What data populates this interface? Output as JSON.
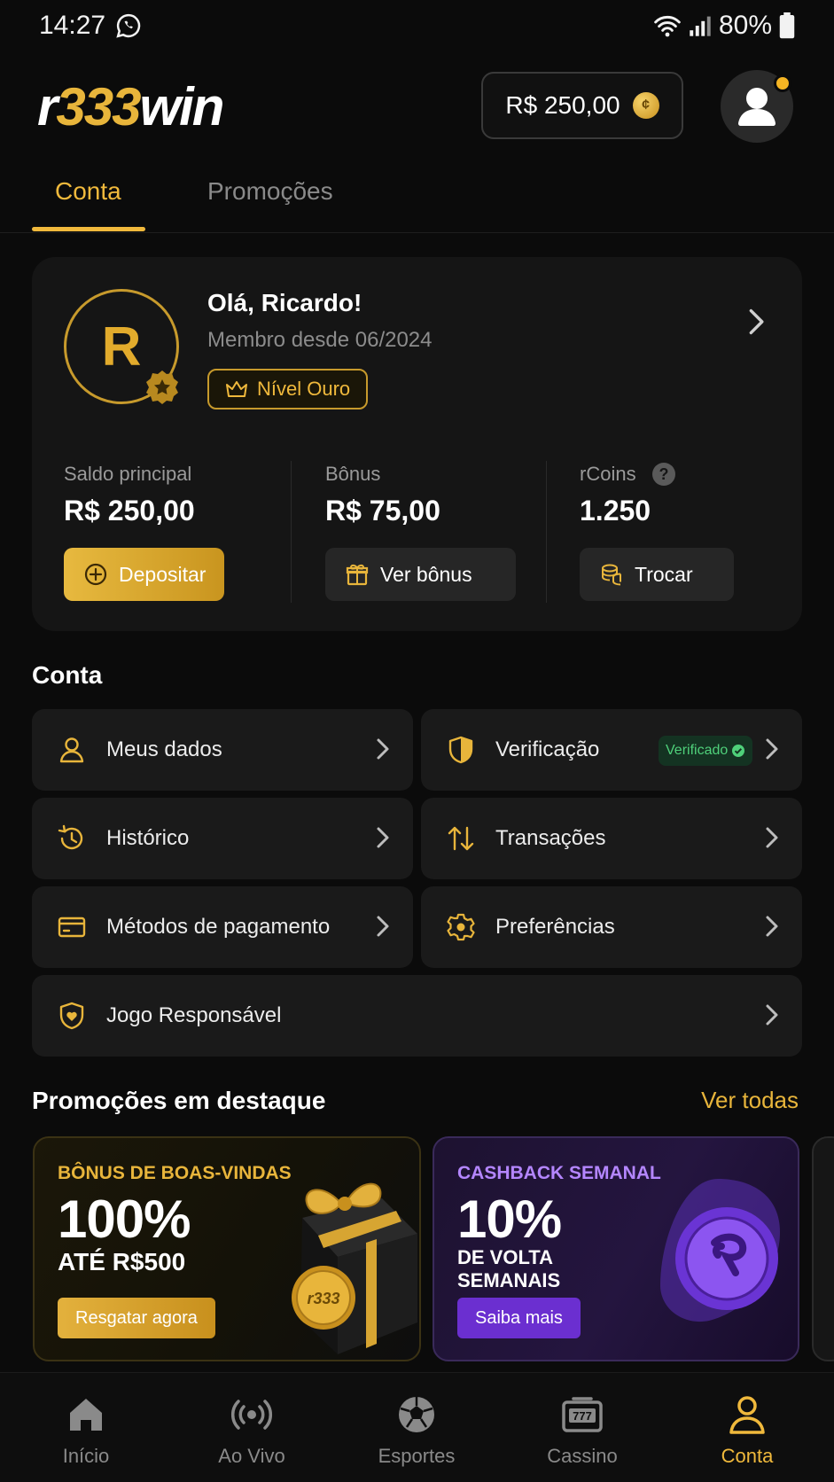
{
  "status_bar": {
    "time": "14:27",
    "battery": "80%"
  },
  "header": {
    "logo": {
      "part1": "r",
      "part2": "333",
      "part3": "win"
    },
    "balance": "R$ 250,00"
  },
  "tabs": [
    {
      "label": "Conta",
      "active": true
    },
    {
      "label": "Promoções",
      "active": false
    }
  ],
  "profile": {
    "initial": "R",
    "greeting": "Olá, Ricardo!",
    "member_since": "Membro desde 06/2024",
    "level": "Nível Ouro"
  },
  "stats": {
    "main": {
      "label": "Saldo principal",
      "value": "R$ 250,00",
      "button": "Depositar"
    },
    "bonus": {
      "label": "Bônus",
      "value": "R$ 75,00",
      "button": "Ver bônus"
    },
    "rcoins": {
      "label": "rCoins",
      "value": "1.250",
      "button": "Trocar"
    }
  },
  "account_section": {
    "title": "Conta",
    "items": [
      {
        "label": "Meus dados",
        "icon": "user-icon"
      },
      {
        "label": "Verificação",
        "icon": "shield-check-icon",
        "badge": "Verificado"
      },
      {
        "label": "Histórico",
        "icon": "history-icon"
      },
      {
        "label": "Transações",
        "icon": "transfer-icon"
      },
      {
        "label": "Métodos de pagamento",
        "icon": "credit-card-icon"
      },
      {
        "label": "Preferências",
        "icon": "gear-icon"
      },
      {
        "label": "Jogo Responsável",
        "icon": "shield-heart-icon"
      }
    ]
  },
  "promos_section": {
    "title": "Promoções em destaque",
    "see_all": "Ver todas",
    "cards": [
      {
        "kicker": "BÔNUS DE BOAS-VINDAS",
        "big": "100%",
        "sub": "ATÉ R$500",
        "button": "Resgatar agora",
        "coin_text": "r333"
      },
      {
        "kicker": "CASHBACK SEMANAL",
        "big": "10%",
        "sub1": "DE VOLTA",
        "sub2": "SEMANAIS",
        "button": "Saiba mais"
      }
    ]
  },
  "bottom_nav": [
    {
      "label": "Início",
      "icon": "home-icon"
    },
    {
      "label": "Ao Vivo",
      "icon": "live-broadcast-icon"
    },
    {
      "label": "Esportes",
      "icon": "soccer-ball-icon"
    },
    {
      "label": "Cassino",
      "icon": "slot-machine-icon"
    },
    {
      "label": "Conta",
      "icon": "user-icon",
      "active": true
    }
  ],
  "colors": {
    "accent": "#f0b93c",
    "background": "#0b0b0b",
    "card": "#151515",
    "purple": "#7c3ee0",
    "verified_green": "#4fd07a"
  }
}
